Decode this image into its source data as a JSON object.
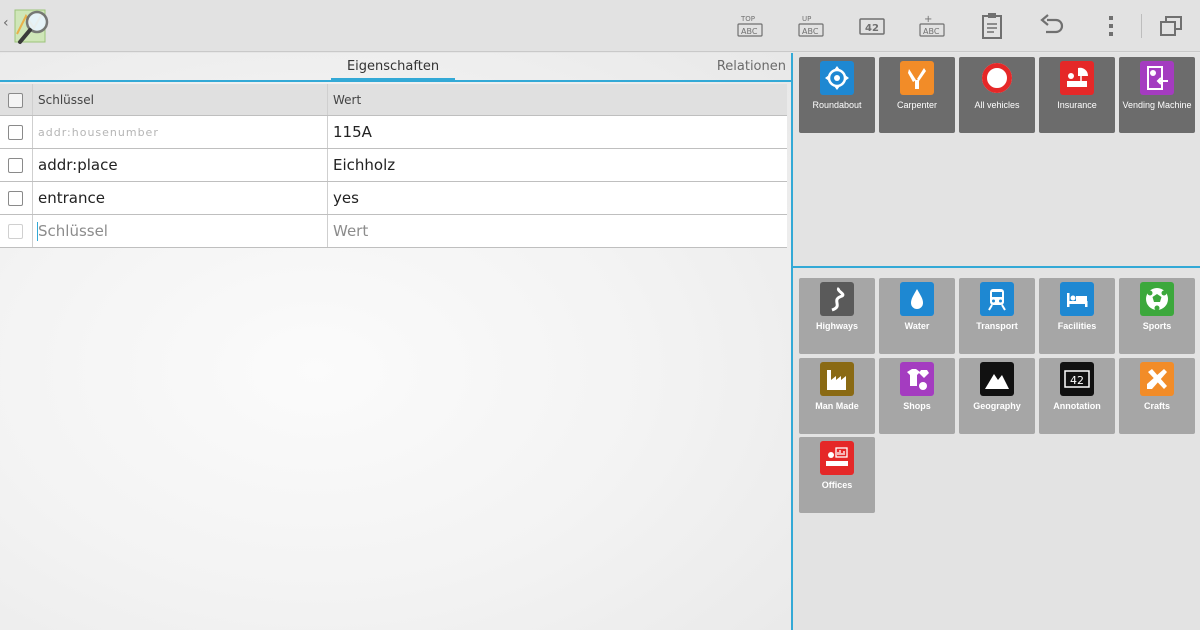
{
  "tabs": {
    "properties": "Eigenschaften",
    "relations": "Relationen"
  },
  "table": {
    "headers": {
      "key": "Schlüssel",
      "value": "Wert"
    },
    "rows": [
      {
        "key": "addr:housenumber",
        "value": "115A"
      },
      {
        "key": "addr:place",
        "value": "Eichholz"
      },
      {
        "key": "entrance",
        "value": "yes"
      }
    ],
    "new_row": {
      "key_placeholder": "Schlüssel",
      "value_placeholder": "Wert"
    }
  },
  "toolbar": {
    "icons": [
      "top-abc-icon",
      "up-abc-icon",
      "42-icon",
      "add-abc-icon",
      "clipboard-icon",
      "undo-icon",
      "overflow-menu-icon",
      "window-icon"
    ],
    "top_label": "TOP",
    "up_label": "UP",
    "abc_label": "ABC",
    "num_label": "42",
    "plus_label": "+"
  },
  "recent_presets": [
    {
      "label": "Roundabout",
      "icon": "roundabout-icon",
      "color": "#1e88d2"
    },
    {
      "label": "Carpenter",
      "icon": "carpenter-icon",
      "color": "#f28c28"
    },
    {
      "label": "All vehicles",
      "icon": "no-vehicles-icon",
      "color": "#e52828"
    },
    {
      "label": "Insurance",
      "icon": "insurance-icon",
      "color": "#e52828"
    },
    {
      "label": "Vending Machine",
      "icon": "vending-machine-icon",
      "color": "#a43cc0"
    }
  ],
  "preset_groups": [
    {
      "label": "Highways",
      "icon": "highway-icon",
      "color": "#5a5a5a"
    },
    {
      "label": "Water",
      "icon": "water-drop-icon",
      "color": "#1e88d2"
    },
    {
      "label": "Transport",
      "icon": "train-icon",
      "color": "#1e88d2"
    },
    {
      "label": "Facilities",
      "icon": "bed-icon",
      "color": "#1e88d2"
    },
    {
      "label": "Sports",
      "icon": "football-icon",
      "color": "#3ca83c"
    },
    {
      "label": "Man Made",
      "icon": "factory-icon",
      "color": "#8a6a14"
    },
    {
      "label": "Shops",
      "icon": "shop-icon",
      "color": "#a43cc0"
    },
    {
      "label": "Geography",
      "icon": "mountain-icon",
      "color": "#111111"
    },
    {
      "label": "Annotation",
      "icon": "annotation-42-icon",
      "color": "#111111"
    },
    {
      "label": "Crafts",
      "icon": "crafts-icon",
      "color": "#f28c28"
    },
    {
      "label": "Offices",
      "icon": "office-icon",
      "color": "#e52828"
    }
  ],
  "colors": {
    "accent": "#33a9d6"
  }
}
